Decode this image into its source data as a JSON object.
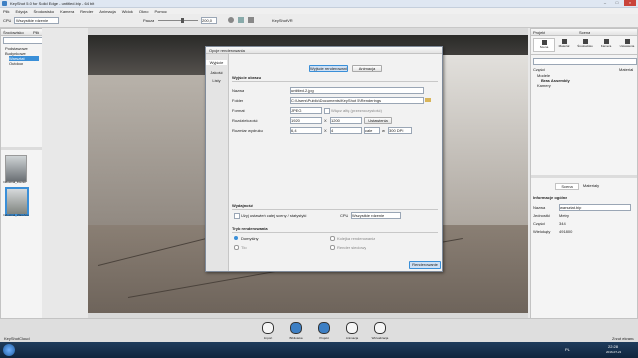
{
  "window": {
    "title": "KeyShot 5.0 for Solid Edge - untitled.bip - 64 bit"
  },
  "menu": [
    "Plik",
    "Edycja",
    "Środowisko",
    "Kamera",
    "Render",
    "Animacja",
    "Widok",
    "Okno",
    "Pomoc"
  ],
  "toolbar": {
    "cpu_label": "CPU",
    "cpu_value": "Wszystkie rdzenie",
    "pause_label": "Pauza",
    "pause_value": "200,0",
    "keyshot_vr": "KeyShotVR"
  },
  "left_panel": {
    "title": "Środowisko",
    "tab": "Plik",
    "tree": [
      "Podstawowe",
      "Budynkowe",
      "Warsztat",
      "Outdoor"
    ],
    "thumbnails": [
      "Industrial_Interior",
      "Industrial_Warehouse"
    ]
  },
  "right_panel": {
    "title": "Projekt",
    "scene_title": "Scena",
    "tabs": [
      "Scena",
      "Materiał",
      "Środowisko",
      "Kamera",
      "Ustawienia"
    ],
    "col_name": "Części",
    "col_material": "Materiał",
    "tree": [
      "Modele",
      "Bras Assembly",
      "Kamery"
    ],
    "subtabs": [
      "Scena",
      "Materiały"
    ],
    "info_title": "Informacje ogólne",
    "props": [
      {
        "label": "Nazwa",
        "value": "warsztat.bip"
      },
      {
        "label": "Jednostki",
        "value": "Metry"
      },
      {
        "label": "Części",
        "value": "344"
      },
      {
        "label": "Wielokąty",
        "value": "491800"
      }
    ]
  },
  "dialog": {
    "title": "Opcje renderowania",
    "side_tabs": [
      "Wyjście",
      "Jakość",
      "Listy"
    ],
    "top_buttons": [
      "Wyjście renderowania",
      "Animacja"
    ],
    "output_section": "Wyjście obrazu",
    "fields": {
      "name_label": "Nazwa",
      "name_value": "untitled.2.jpg",
      "folder_label": "Folder",
      "folder_value": "C:\\Users\\Public\\Documents\\KeyShot 5\\Renderings",
      "format_label": "Format",
      "format_value": "JPEG",
      "alpha_label": "Włącz alfę (przezroczystość)",
      "res_label": "Rozdzielczość",
      "res_w": "1920",
      "res_x": "X",
      "res_h": "1200",
      "res_preset": "Ustawienia",
      "print_label": "Rozmiar wydruku",
      "print_w": "6,4",
      "print_x": "X",
      "print_h": "4",
      "print_unit": "cale",
      "print_at": "w",
      "print_dpi": "300 DPI"
    },
    "advanced_section": "Wydajność",
    "advanced_check": "Użyj ustawień całej sceny / statystyki",
    "cpu_label": "CPU",
    "cpu_value": "Wszystkie rdzenie",
    "mode_section": "Tryb renderowania",
    "modes": [
      "Domyślny",
      "Tło",
      "Kolejka renderowania",
      "Render sieciowy"
    ],
    "render_button": "Renderowanie"
  },
  "bottom_bar": {
    "cloud": "KeyShotCloud",
    "buttons": [
      "Import",
      "Biblioteka",
      "Projekt",
      "Animacja",
      "Wizualizacja"
    ],
    "right_label": "Zrzut ekranu"
  },
  "taskbar": {
    "time": "22:28",
    "date": "2016-07-21",
    "lang": "PL"
  }
}
